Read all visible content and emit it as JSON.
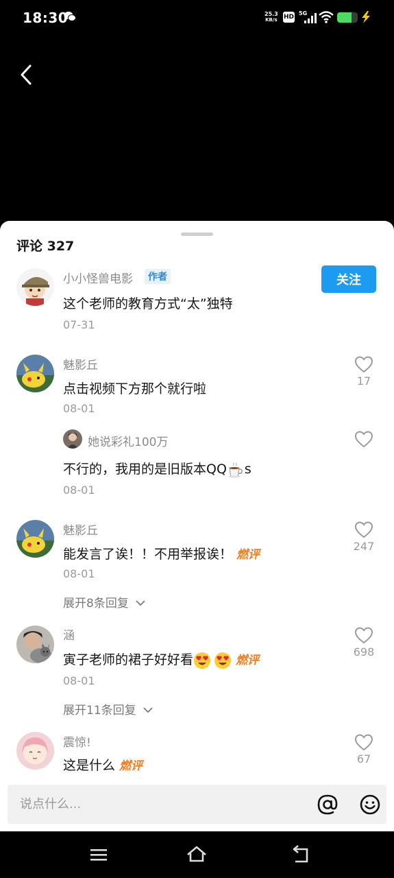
{
  "status_bar": {
    "time": "18:30",
    "net_speed_value": "25.3",
    "net_speed_unit": "KB/s",
    "hd_label": "HD",
    "network_label": "5G",
    "battery_level": 0.7,
    "icons": [
      "wechat-icon",
      "wifi-icon",
      "battery-icon",
      "charging-icon"
    ]
  },
  "header": {
    "back_icon": "chevron-left-icon"
  },
  "comments_panel": {
    "title": "评论 327",
    "follow_label": "关注",
    "comments": [
      {
        "user": "小小怪兽电影",
        "tag": "作者",
        "text": "这个老师的教育方式“太”独特",
        "date": "07-31"
      },
      {
        "user": "魅影丘",
        "text": "点击视频下方那个就行啦",
        "date": "08-01",
        "likes": "17",
        "reply": {
          "user": "她说彩礼100万",
          "text": "不行的，我用的是旧版本QQ",
          "text_suffix": "s",
          "date": "08-01"
        }
      },
      {
        "user": "魅影丘",
        "text": "能发言了诶！！不用举报诶！",
        "badge": "燃评",
        "date": "08-01",
        "likes": "247",
        "expand": "展开8条回复"
      },
      {
        "user": "涵",
        "text": "寅子老师的裙子好好看",
        "badge": "燃评",
        "date": "08-01",
        "likes": "698",
        "expand": "展开11条回复"
      },
      {
        "user": "震惊!",
        "text": "这是什么",
        "badge": "燃评",
        "likes": "67"
      }
    ]
  },
  "input_bar": {
    "placeholder": "说点什么..."
  },
  "colors": {
    "accent": "#1d9bf0",
    "hot": "#f07f22",
    "sheet": "#ffffff"
  }
}
